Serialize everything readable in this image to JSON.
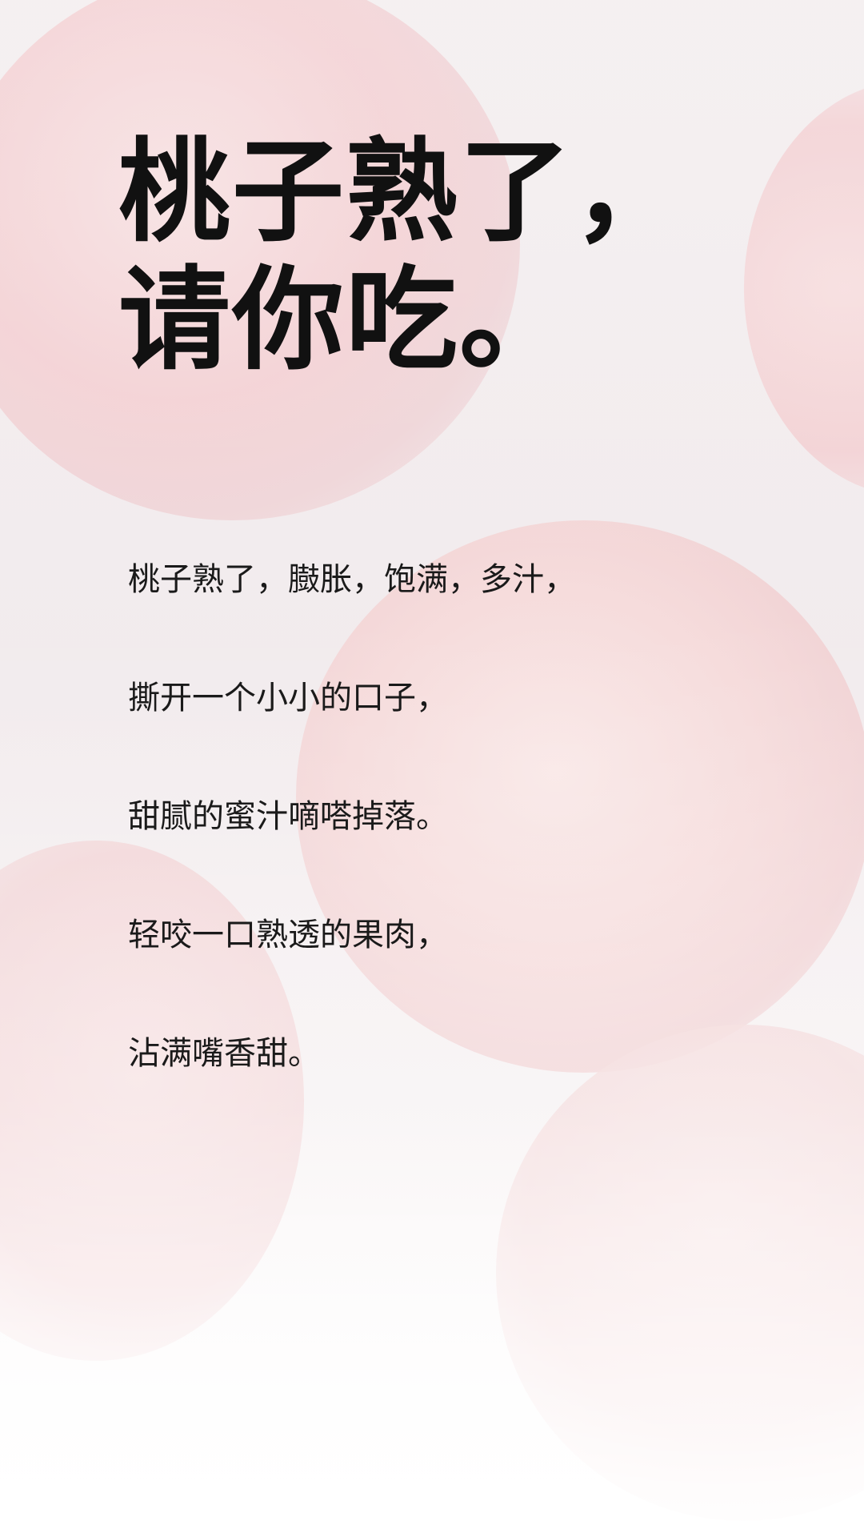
{
  "title": {
    "line1": "桃子熟了，",
    "line2": "请你吃。"
  },
  "poem": {
    "lines": [
      "桃子熟了，臌胀，饱满，多汁，",
      "撕开一个小小的口子，",
      "甜腻的蜜汁嘀嗒掉落。",
      "轻咬一口熟透的果肉，",
      "沾满嘴香甜。"
    ]
  },
  "colors": {
    "text": "#111111",
    "peach": "#f3cfd2",
    "background": "#f3eeef"
  }
}
